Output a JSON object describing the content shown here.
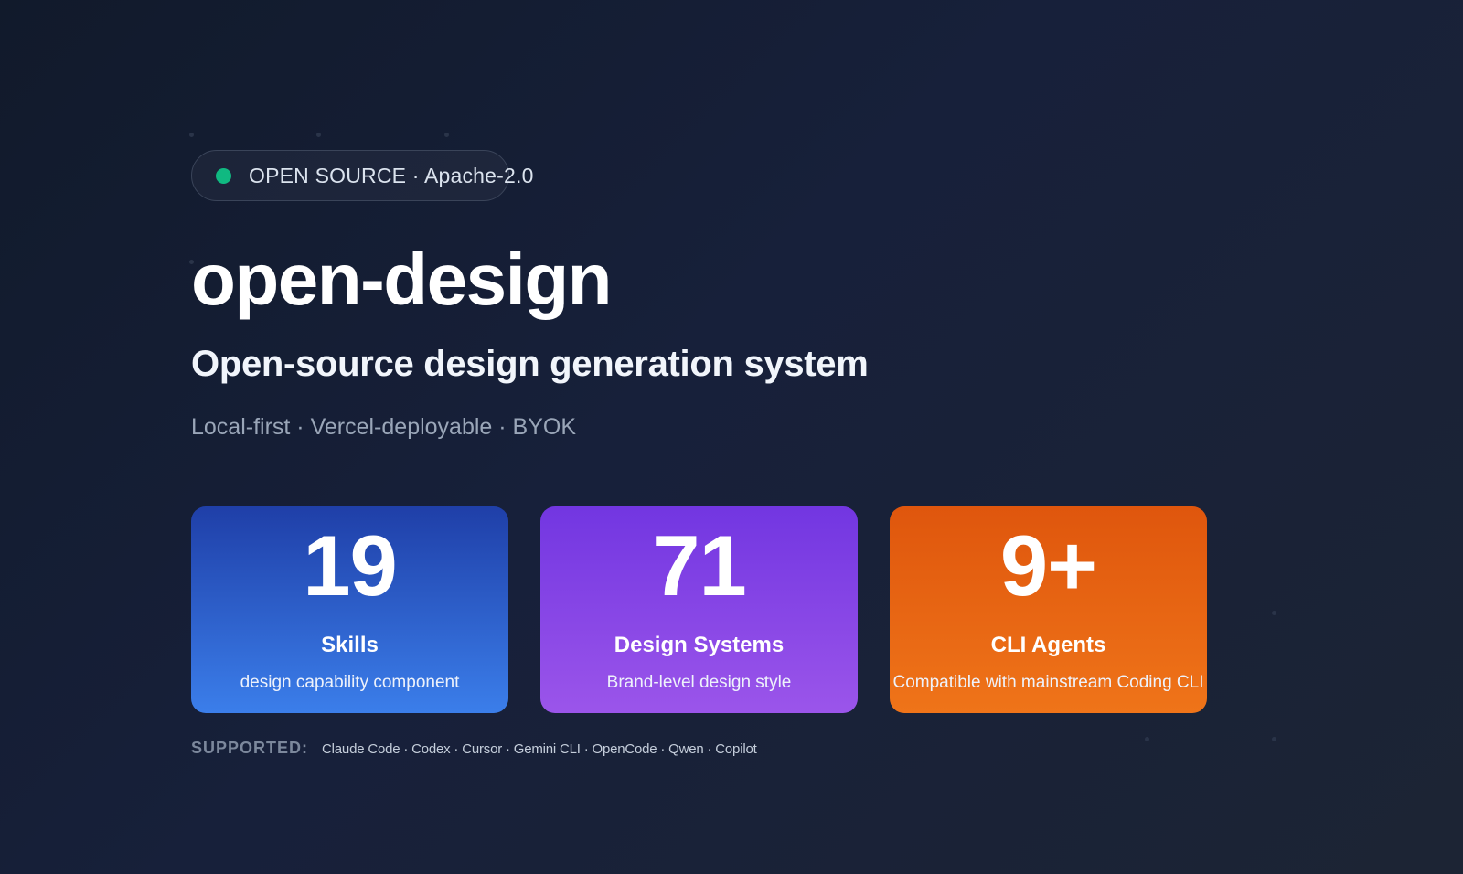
{
  "badge": {
    "text": "OPEN SOURCE · Apache-2.0",
    "dot_color": "#10b981"
  },
  "hero": {
    "title": "open-design",
    "subtitle": "Open-source design generation system",
    "tagline": "Local-first · Vercel-deployable · BYOK"
  },
  "stats": [
    {
      "number": "19",
      "label": "Skills",
      "description": "design capability component",
      "color": "#2f66d8"
    },
    {
      "number": "71",
      "label": "Design Systems",
      "description": "Brand-level design style",
      "color": "#8746e6"
    },
    {
      "number": "9+",
      "label": "CLI Agents",
      "description": "Compatible with mainstream Coding CLI",
      "color": "#e66612"
    }
  ],
  "supported": {
    "label": "SUPPORTED:",
    "list": "Claude Code · Codex · Cursor · Gemini CLI · OpenCode · Qwen · Copilot"
  }
}
